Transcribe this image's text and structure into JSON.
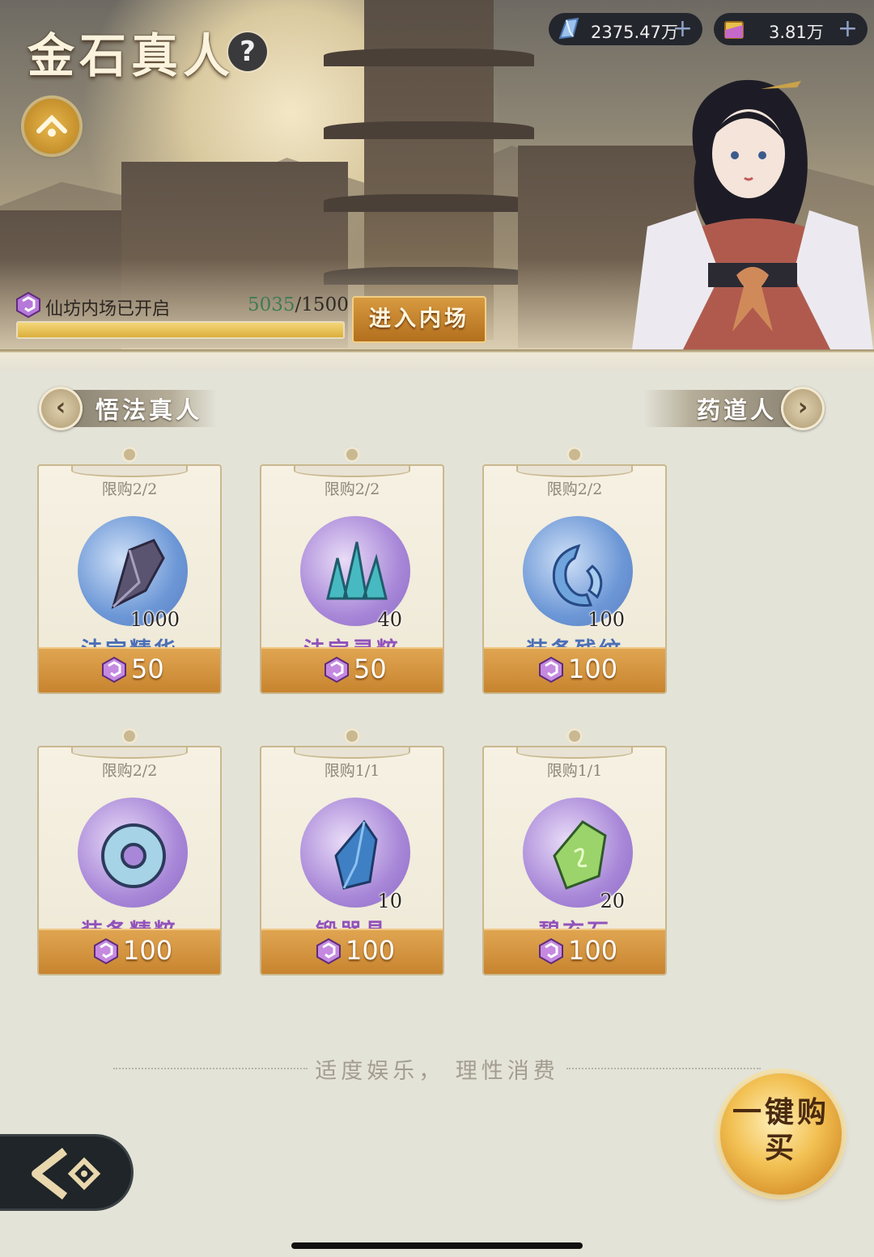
{
  "header": {
    "title": "金石真人",
    "help_icon": "?",
    "currencies": [
      {
        "icon": "spirit-crystal-icon",
        "value": "2375.47万"
      },
      {
        "icon": "gold-ticket-icon",
        "value": "3.81万"
      }
    ]
  },
  "inner_market": {
    "label": "仙坊内场已开启",
    "current": "5035",
    "total": "/1500",
    "progress_fraction": 1.0,
    "enter_button": "进入内场"
  },
  "nav": {
    "prev_label": "悟法真人",
    "next_label": "药道人"
  },
  "items": [
    {
      "limit": "限购2/2",
      "name": "法宝精华",
      "count": "1000",
      "price": "50",
      "rarity_color": "blue"
    },
    {
      "limit": "限购2/2",
      "name": "法宝灵粹",
      "count": "40",
      "price": "50",
      "rarity_color": "purple"
    },
    {
      "limit": "限购2/2",
      "name": "装备残纹",
      "count": "100",
      "price": "100",
      "rarity_color": "blue"
    },
    {
      "limit": "限购2/2",
      "name": "装备精粹",
      "count": "",
      "price": "100",
      "rarity_color": "purple"
    },
    {
      "limit": "限购1/1",
      "name": "锻器晶",
      "count": "10",
      "price": "100",
      "rarity_color": "purple"
    },
    {
      "limit": "限购1/1",
      "name": "碧玄石",
      "count": "20",
      "price": "100",
      "rarity_color": "purple"
    }
  ],
  "footer": {
    "notice": "适度娱乐， 理性消费",
    "buy_all": "一键购买"
  },
  "colors": {
    "accent_gold": "#d79a40",
    "blue_name": "#4b6fb6",
    "purple_name": "#9152ba"
  }
}
